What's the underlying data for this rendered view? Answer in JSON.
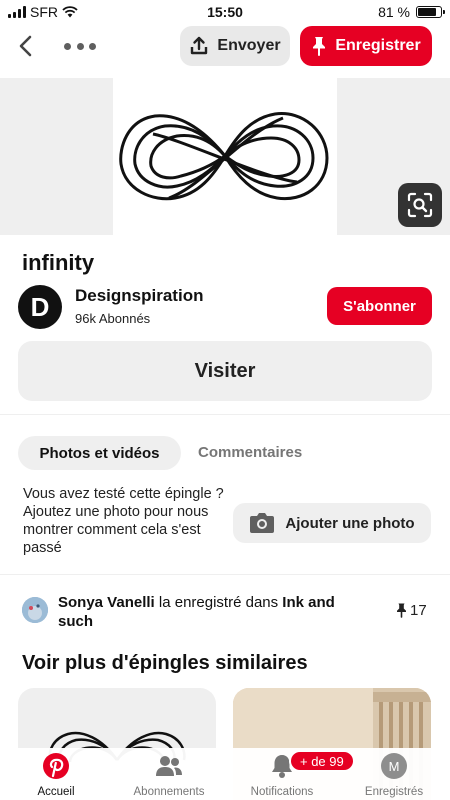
{
  "status_bar": {
    "carrier": "SFR",
    "time": "15:50",
    "battery": "81 %",
    "battery_level": 0.81
  },
  "toolbar": {
    "send_label": "Envoyer",
    "save_label": "Enregistrer"
  },
  "pin": {
    "title": "infinity",
    "author": {
      "initial": "D",
      "name": "Designspiration",
      "followers": "96k Abonnés"
    },
    "follow_label": "S'abonner",
    "visit_label": "Visiter"
  },
  "tabs": [
    {
      "label": "Photos et vidéos",
      "active": true
    },
    {
      "label": "Commentaires",
      "active": false
    }
  ],
  "photo_prompt": {
    "text": "Vous avez testé cette épingle ? Ajoutez une photo pour nous montrer comment cela s'est passé",
    "button_label": "Ajouter une photo"
  },
  "activity": {
    "user": "Sonya Vanelli",
    "action": " la enregistré dans ",
    "board": "Ink and such",
    "save_count": "17"
  },
  "more_section": {
    "title": "Voir plus d'épingles similaires"
  },
  "bottom_nav": {
    "items": [
      {
        "label": "Accueil",
        "icon": "pinterest-icon",
        "active": true
      },
      {
        "label": "Abonnements",
        "icon": "people-icon",
        "active": false
      },
      {
        "label": "Notifications",
        "icon": "bell-icon",
        "active": false
      },
      {
        "label": "Enregistrés",
        "icon": "profile-avatar",
        "active": false,
        "initial": "M"
      }
    ],
    "notification_badge": "+ de 99"
  },
  "colors": {
    "brand_red": "#e60023",
    "button_gray": "#efefef",
    "muted_text": "#767676"
  }
}
